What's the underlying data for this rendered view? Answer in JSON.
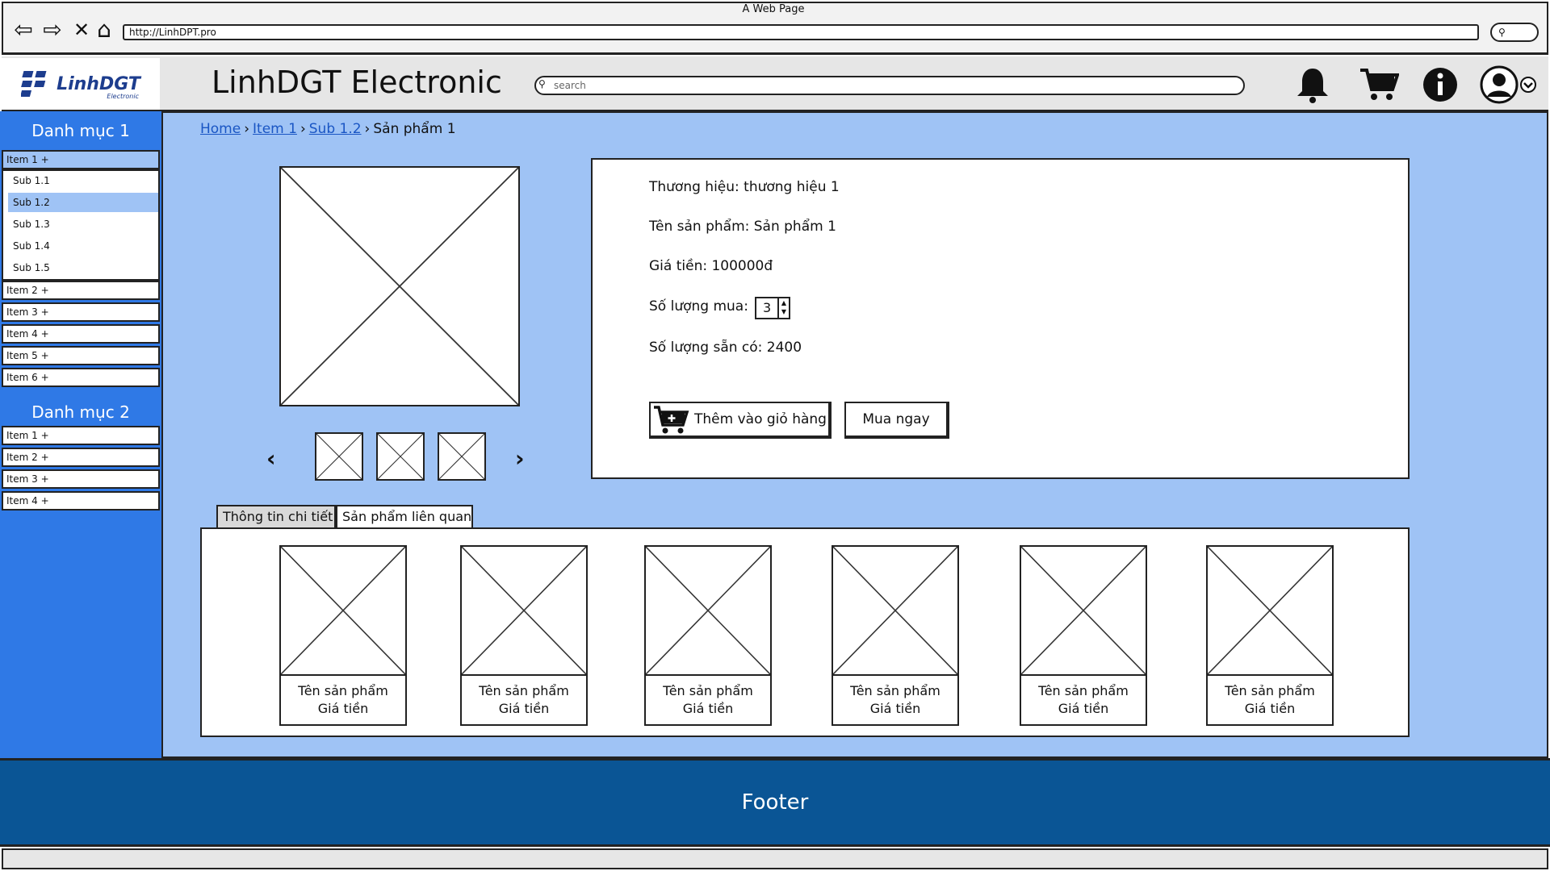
{
  "window": {
    "title": "A Web Page",
    "url": "http://LinhDPT.pro"
  },
  "header": {
    "logo_text": "LinhDGT",
    "logo_sub": "Electronic",
    "site_title": "LinhDGT Electronic",
    "search_placeholder": "search"
  },
  "sidebar": {
    "categories": [
      {
        "title": "Danh mục 1",
        "items": [
          "Item 1 +",
          "Item 2 +",
          "Item 3 +",
          "Item 4 +",
          "Item 5 +",
          "Item 6 +"
        ],
        "subitems": [
          "Sub 1.1",
          "Sub 1.2",
          "Sub 1.3",
          "Sub 1.4",
          "Sub 1.5"
        ]
      },
      {
        "title": "Danh mục 2",
        "items": [
          "Item 1 +",
          "Item 2 +",
          "Item 3 +",
          "Item 4 +"
        ]
      }
    ]
  },
  "breadcrumb": [
    "Home",
    "Item 1",
    "Sub 1.2",
    "Sản phẩm 1"
  ],
  "product": {
    "brand": "Thương hiệu: thương hiệu 1",
    "name": "Tên sản phẩm: Sản phẩm 1",
    "price": "Giá tiền: 100000đ",
    "qty_label": "Số lượng mua:",
    "qty_value": "3",
    "stock": "Số lượng sẵn có: 2400",
    "add_to_cart": "Thêm vào giỏ hàng",
    "buy_now": "Mua ngay"
  },
  "tabs": [
    "Thông tin chi tiết",
    "Sản phẩm liên quan"
  ],
  "related": [
    {
      "name": "Tên sản phẩm",
      "price": "Giá tiền"
    },
    {
      "name": "Tên sản phẩm",
      "price": "Giá tiền"
    },
    {
      "name": "Tên sản phẩm",
      "price": "Giá tiền"
    },
    {
      "name": "Tên sản phẩm",
      "price": "Giá tiền"
    },
    {
      "name": "Tên sản phẩm",
      "price": "Giá tiền"
    },
    {
      "name": "Tên sản phẩm",
      "price": "Giá tiền"
    }
  ],
  "footer": "Footer",
  "colors": {
    "sidebar": "#2f79e6",
    "main_bg": "#9fc3f5",
    "footer": "#0a5595",
    "link": "#1a56c4"
  }
}
